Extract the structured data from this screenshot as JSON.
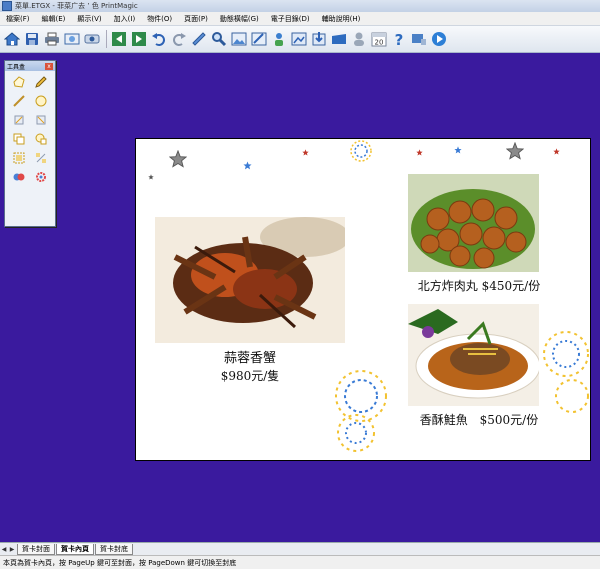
{
  "window": {
    "title": "菜單.ETGX - 菲菜广去 ’ 色 PrintMagic"
  },
  "menu": [
    "檔案(F)",
    "編輯(E)",
    "顯示(V)",
    "加入(I)",
    "物件(O)",
    "頁面(P)",
    "動態橫幅(G)",
    "電子目錄(D)",
    "輔助說明(H)"
  ],
  "toolbar_icons": [
    "home-icon",
    "save-icon",
    "print-icon",
    "print-preview-icon",
    "image-icon",
    "first-page-icon",
    "prev-page-icon",
    "next-page-icon",
    "undo-icon",
    "redo-icon",
    "zoom-icon",
    "search-icon",
    "photo-icon",
    "photo-edit-icon",
    "text-icon",
    "export-icon",
    "import-icon",
    "share-icon",
    "user-icon",
    "calendar-icon",
    "help-icon",
    "video-icon",
    "play-icon"
  ],
  "calendar_day": "20",
  "toolbox": {
    "title": "工具盒",
    "close": "x",
    "tools": [
      "polygon-tool-icon",
      "pencil-tool-icon",
      "line-tool-icon",
      "circle-tool-icon",
      "rotate-left-tool-icon",
      "rotate-right-tool-icon",
      "copy-tool-icon",
      "paste-tool-icon",
      "group-tool-icon",
      "ungroup-tool-icon",
      "color-tool-icon",
      "effects-tool-icon"
    ]
  },
  "menu_page": {
    "items": [
      {
        "name": "蒜蓉香蟹",
        "price": "$980元/隻",
        "photo": "crab-photo"
      },
      {
        "name": "北方炸肉丸",
        "price": "$450元/份",
        "photo": "meatballs-photo"
      },
      {
        "name": "香酥鮭魚",
        "price": "$500元/份",
        "photo": "salmon-photo"
      }
    ]
  },
  "tabs": [
    "賀卡封面",
    "賀卡內頁",
    "賀卡封底"
  ],
  "active_tab": 1,
  "status": "本頁為賀卡內頁，按 PageUp 鍵可至封面，按 PageDown 鍵可切換至封底",
  "colors": {
    "workspace_bg": "#3a1a9e",
    "page_bg": "#ffffff"
  }
}
